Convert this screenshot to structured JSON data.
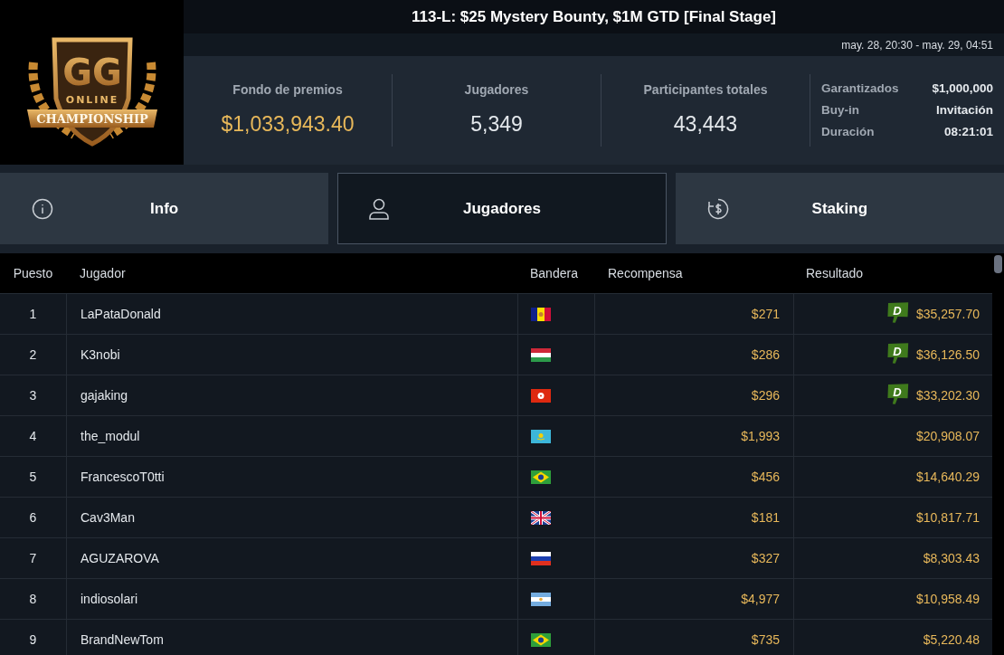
{
  "logo": {
    "monogram": "GG",
    "line_1": "ONLINE",
    "line_2": "CHAMPIONSHIP"
  },
  "title": "113-L: $25 Mystery Bounty, $1M GTD [Final Stage]",
  "dates": "may. 28, 20:30 - may. 29, 04:51",
  "stats": [
    {
      "label": "Fondo de premios",
      "value": "$1,033,943.40",
      "highlight": true
    },
    {
      "label": "Jugadores",
      "value": "5,349",
      "highlight": false
    },
    {
      "label": "Participantes totales",
      "value": "43,443",
      "highlight": false
    }
  ],
  "details": [
    {
      "label": "Garantizados",
      "value": "$1,000,000"
    },
    {
      "label": "Buy-in",
      "value": "Invitación"
    },
    {
      "label": "Duración",
      "value": "08:21:01"
    }
  ],
  "tabs": [
    {
      "label": "Info",
      "kind": "info",
      "selected": false
    },
    {
      "label": "Jugadores",
      "kind": "players",
      "selected": true
    },
    {
      "label": "Staking",
      "kind": "staking",
      "selected": false
    }
  ],
  "table": {
    "columns": [
      "Puesto",
      "Jugador",
      "Bandera",
      "Recompensa",
      "Resultado"
    ],
    "rows": [
      {
        "rank": "1",
        "player": "LaPataDonald",
        "flag": {
          "kind": "ad"
        },
        "bounty": "$271",
        "result": "$35,257.70",
        "badge": "D"
      },
      {
        "rank": "2",
        "player": "K3nobi",
        "flag": {
          "kind": "hu"
        },
        "bounty": "$286",
        "result": "$36,126.50",
        "badge": "D"
      },
      {
        "rank": "3",
        "player": "gajaking",
        "flag": {
          "kind": "hk"
        },
        "bounty": "$296",
        "result": "$33,202.30",
        "badge": "D"
      },
      {
        "rank": "4",
        "player": "the_modul",
        "flag": {
          "kind": "kz"
        },
        "bounty": "$1,993",
        "result": "$20,908.07"
      },
      {
        "rank": "5",
        "player": "FrancescoT0tti",
        "flag": {
          "kind": "br"
        },
        "bounty": "$456",
        "result": "$14,640.29"
      },
      {
        "rank": "6",
        "player": "Cav3Man",
        "flag": {
          "kind": "gb"
        },
        "bounty": "$181",
        "result": "$10,817.71"
      },
      {
        "rank": "7",
        "player": "AGUZAROVA",
        "flag": {
          "kind": "ru"
        },
        "bounty": "$327",
        "result": "$8,303.43"
      },
      {
        "rank": "8",
        "player": "indiosolari",
        "flag": {
          "kind": "ar"
        },
        "bounty": "$4,977",
        "result": "$10,958.49"
      },
      {
        "rank": "9",
        "player": "BrandNewTom",
        "flag": {
          "kind": "br"
        },
        "bounty": "$735",
        "result": "$5,220.48"
      }
    ]
  }
}
